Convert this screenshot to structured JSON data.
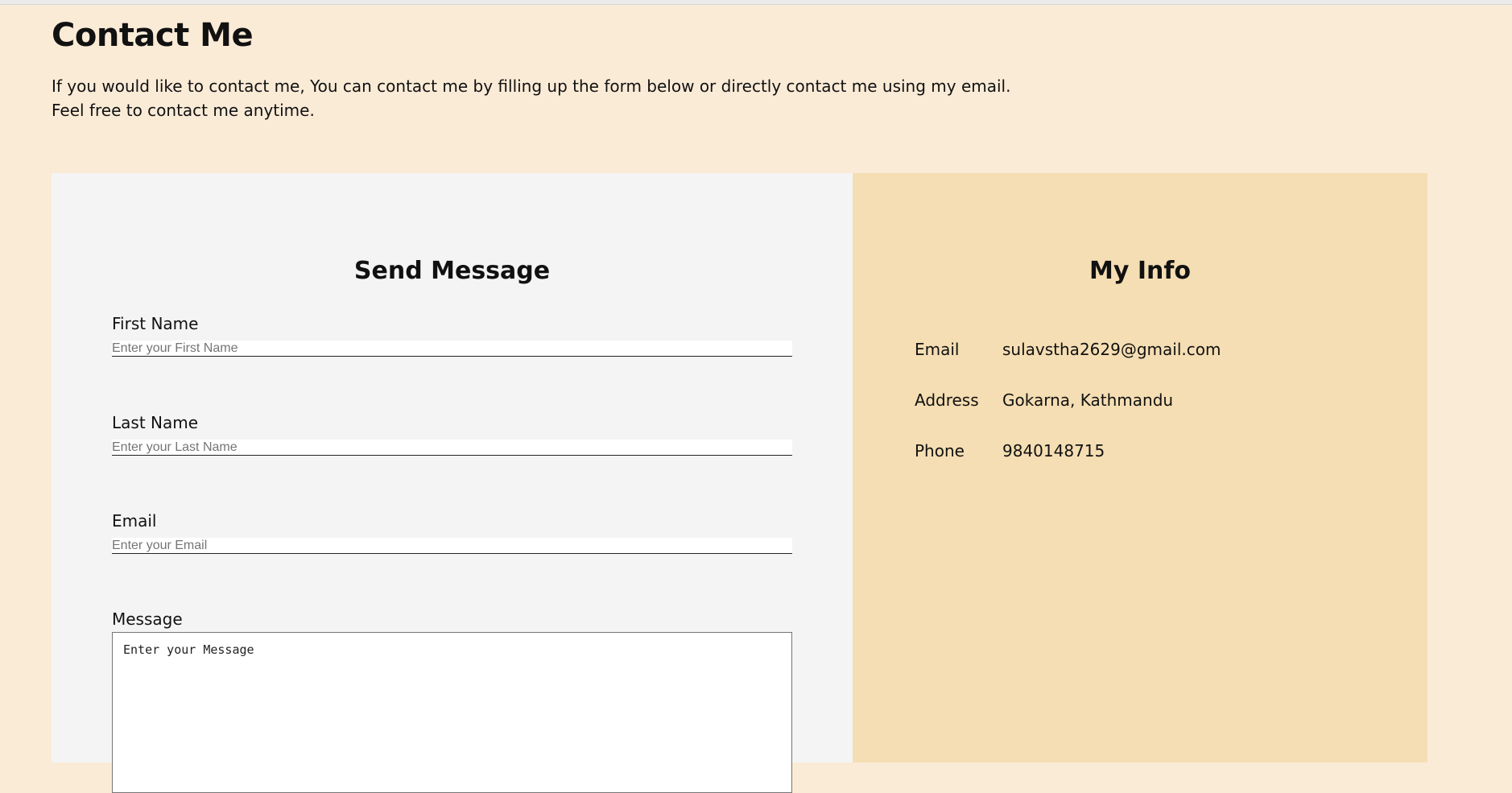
{
  "header": {
    "title": "Contact Me",
    "intro_line1": "If you would like to contact me, You can contact me by filling up the form below or directly contact me using my email.",
    "intro_line2": "Feel free to contact me anytime."
  },
  "form": {
    "title": "Send Message",
    "first_name": {
      "label": "First Name",
      "placeholder": "Enter your First Name",
      "value": ""
    },
    "last_name": {
      "label": "Last Name",
      "placeholder": "Enter your Last Name",
      "value": ""
    },
    "email": {
      "label": "Email",
      "placeholder": "Enter your Email",
      "value": ""
    },
    "message": {
      "label": "Message",
      "placeholder": "Enter your Message",
      "value": ""
    }
  },
  "info": {
    "title": "My Info",
    "rows": [
      {
        "key": "Email",
        "value": "sulavstha2629@gmail.com"
      },
      {
        "key": "Address",
        "value": "Gokarna, Kathmandu"
      },
      {
        "key": "Phone",
        "value": "9840148715"
      }
    ]
  },
  "colors": {
    "page_background": "#faebd7",
    "form_panel": "#f4f4f4",
    "info_panel": "#f5deb3"
  }
}
